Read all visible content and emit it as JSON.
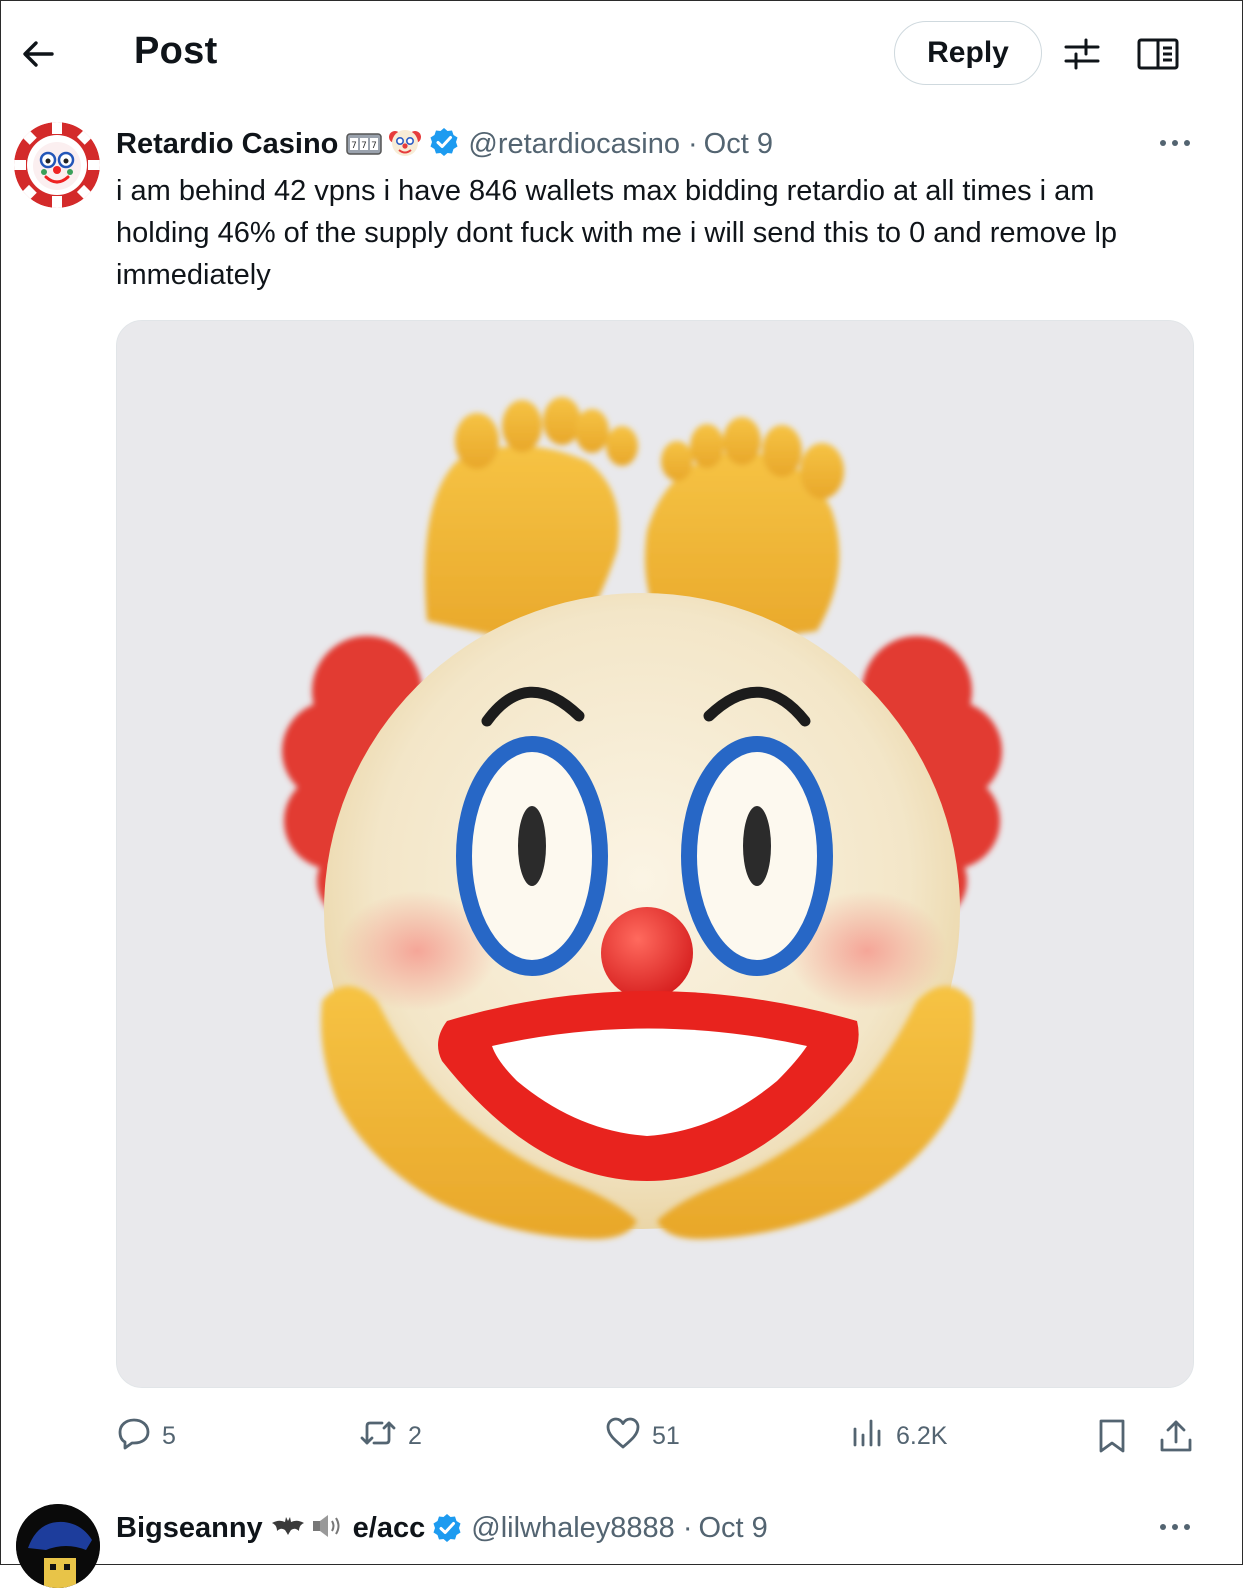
{
  "header": {
    "title": "Post",
    "reply_label": "Reply"
  },
  "post": {
    "display_name": "Retardio Casino",
    "handle": "@retardiocasino",
    "date": "Oct 9",
    "text": "i am behind 42 vpns i have 846 wallets max bidding retardio at all times i am holding 46% of the supply dont fuck with me i will send this to 0 and remove lp immediately",
    "name_emojis": [
      "slot-machine-emoji",
      "clown-face-emoji"
    ],
    "verified": true,
    "media": {
      "subject": "clown-face-emoji-with-hands-and-feet"
    },
    "stats": {
      "replies": "5",
      "reposts": "2",
      "likes": "51",
      "views": "6.2K"
    }
  },
  "next_post": {
    "display_name_part1": "Bigseanny",
    "display_name_part2": "e/acc",
    "name_emojis": [
      "bat-emoji",
      "speaker-emoji"
    ],
    "handle": "@lilwhaley8888",
    "date": "Oct 9",
    "verified": true
  },
  "colors": {
    "text_primary": "#0f1419",
    "text_secondary": "#536471",
    "verified_blue": "#1d9bf0",
    "border": "#cfd9de"
  }
}
